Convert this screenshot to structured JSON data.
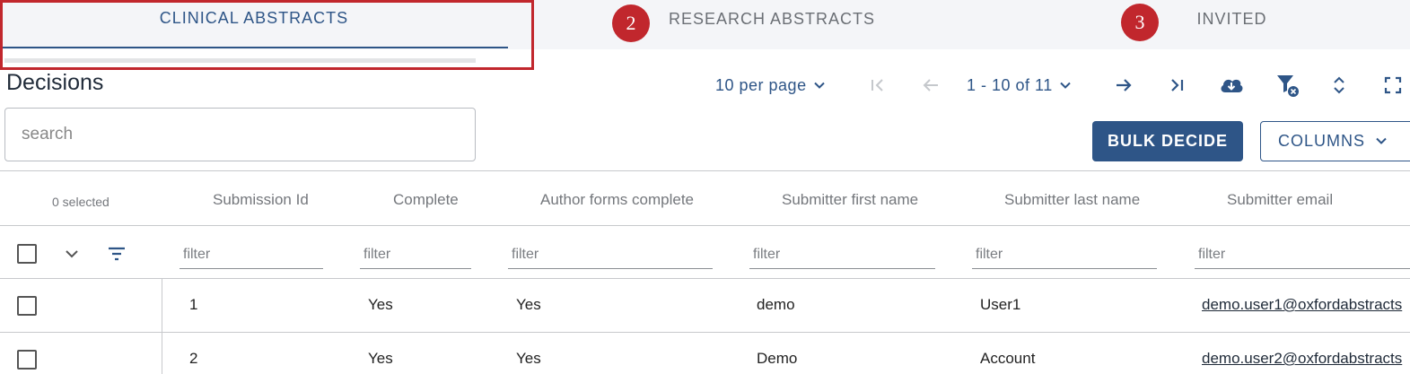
{
  "tabs": [
    {
      "label": "CLINICAL ABSTRACTS",
      "active": true
    },
    {
      "label": "RESEARCH ABSTRACTS",
      "active": false
    },
    {
      "label": "INVITED",
      "active": false
    }
  ],
  "annotations": {
    "badge_research": "2",
    "badge_invited": "3",
    "highlight_color": "#c1272d"
  },
  "page_title": "Decisions",
  "pagination": {
    "per_page_label": "10 per page",
    "range_label": "1 - 10 of 11",
    "icons": [
      "first-page-icon",
      "previous-page-icon",
      "next-page-icon",
      "last-page-icon",
      "cloud-download-icon",
      "clear-filter-icon",
      "expand-collapse-icon",
      "fullscreen-icon"
    ]
  },
  "search": {
    "placeholder": "search",
    "value": ""
  },
  "actions": {
    "bulk_decide_label": "BULK DECIDE",
    "columns_label": "COLUMNS"
  },
  "table": {
    "selected_label": "0 selected",
    "columns": [
      "Submission Id",
      "Complete",
      "Author forms complete",
      "Submitter first name",
      "Submitter last name",
      "Submitter email"
    ],
    "filter_placeholder": "filter",
    "rows": [
      {
        "id": "1",
        "complete": "Yes",
        "author_forms": "Yes",
        "first_name": "demo",
        "last_name": "User1",
        "email": "demo.user1@oxfordabstracts"
      },
      {
        "id": "2",
        "complete": "Yes",
        "author_forms": "Yes",
        "first_name": "Demo",
        "last_name": "Account",
        "email": "demo.user2@oxfordabstracts"
      }
    ]
  },
  "colors": {
    "accent": "#2e5587",
    "tab_bar_bg": "#f4f5f8",
    "muted_text": "#74777c"
  }
}
